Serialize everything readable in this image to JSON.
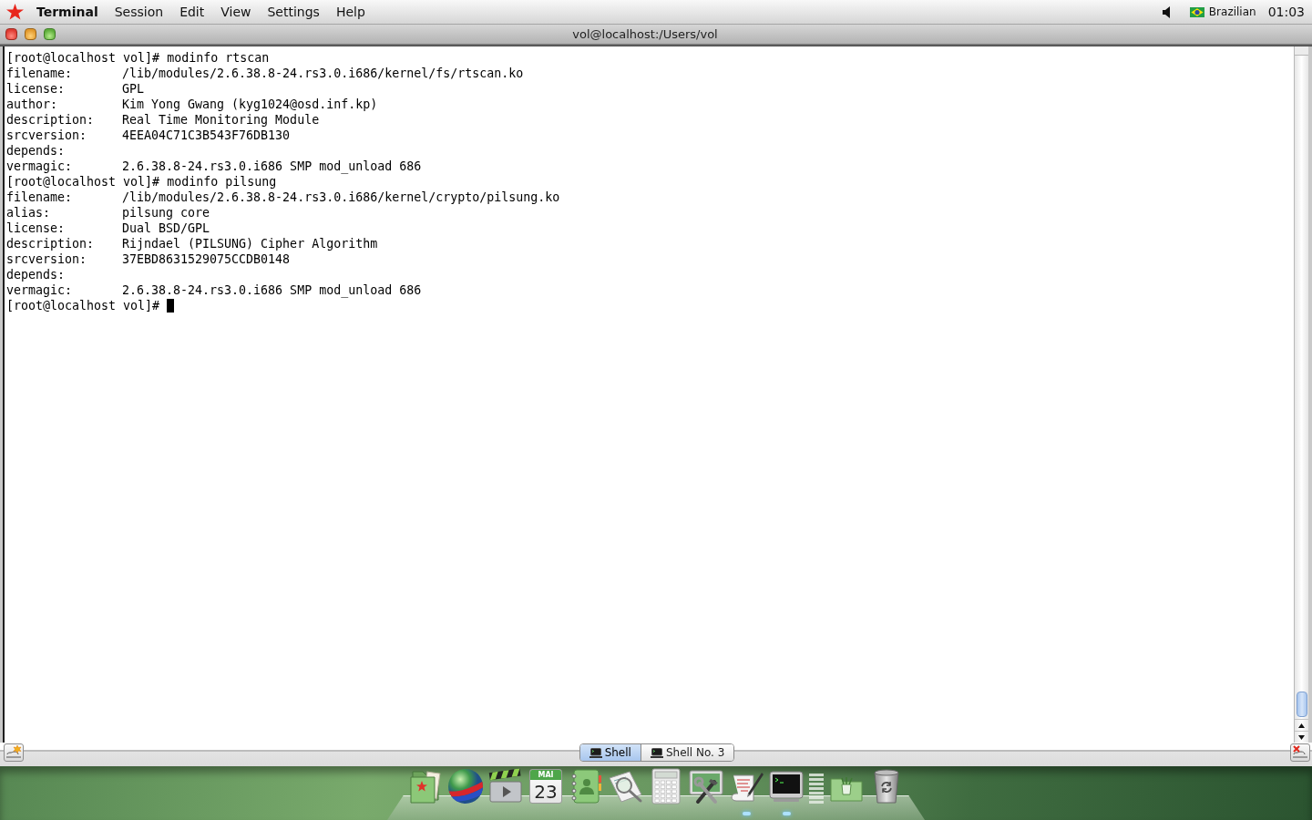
{
  "menu_bar": {
    "app_menu": "Terminal",
    "menus": [
      "Session",
      "Edit",
      "View",
      "Settings",
      "Help"
    ],
    "input_source": "Brazilian",
    "clock": "01:03"
  },
  "window": {
    "title": "vol@localhost:/Users/vol"
  },
  "terminal": {
    "lines": [
      {
        "kind": "prompt",
        "prompt": "[root@localhost vol]#",
        "command": "modinfo rtscan"
      },
      {
        "kind": "field",
        "key": "filename:",
        "value": "/lib/modules/2.6.38.8-24.rs3.0.i686/kernel/fs/rtscan.ko"
      },
      {
        "kind": "field",
        "key": "license:",
        "value": "GPL"
      },
      {
        "kind": "field",
        "key": "author:",
        "value": "Kim Yong Gwang (kyg1024@osd.inf.kp)"
      },
      {
        "kind": "field",
        "key": "description:",
        "value": "Real Time Monitoring Module"
      },
      {
        "kind": "field",
        "key": "srcversion:",
        "value": "4EEA04C71C3B543F76DB130"
      },
      {
        "kind": "field",
        "key": "depends:"
      },
      {
        "kind": "field",
        "key": "vermagic:",
        "value": "2.6.38.8-24.rs3.0.i686 SMP mod_unload 686"
      },
      {
        "kind": "prompt",
        "prompt": "[root@localhost vol]#",
        "command": "modinfo pilsung"
      },
      {
        "kind": "field",
        "key": "filename:",
        "value": "/lib/modules/2.6.38.8-24.rs3.0.i686/kernel/crypto/pilsung.ko"
      },
      {
        "kind": "field",
        "key": "alias:",
        "value": "pilsung core"
      },
      {
        "kind": "field",
        "key": "license:",
        "value": "Dual BSD/GPL"
      },
      {
        "kind": "field",
        "key": "description:",
        "value": "Rijndael (PILSUNG) Cipher Algorithm"
      },
      {
        "kind": "field",
        "key": "srcversion:",
        "value": "37EBD8631529075CCDB0148"
      },
      {
        "kind": "field",
        "key": "depends:"
      },
      {
        "kind": "field",
        "key": "vermagic:",
        "value": "2.6.38.8-24.rs3.0.i686 SMP mod_unload 686"
      },
      {
        "kind": "prompt",
        "prompt": "[root@localhost vol]#"
      }
    ],
    "cursor": true
  },
  "tabs": [
    {
      "label": "Shell",
      "selected": true
    },
    {
      "label": "Shell No. 3",
      "selected": false
    }
  ],
  "dock": {
    "items": [
      {
        "kind": "app-folder",
        "running": false
      },
      {
        "kind": "globe",
        "running": false
      },
      {
        "kind": "clapper",
        "running": false
      },
      {
        "kind": "calendar",
        "month": "MAI",
        "day": "23",
        "running": false
      },
      {
        "kind": "contacts",
        "running": false
      },
      {
        "kind": "preview",
        "running": false
      },
      {
        "kind": "calculator",
        "running": false
      },
      {
        "kind": "tools",
        "running": false
      },
      {
        "kind": "script",
        "running": true
      },
      {
        "kind": "terminal",
        "running": true
      },
      {
        "kind": "stack",
        "running": false
      },
      {
        "kind": "folder",
        "running": false
      },
      {
        "kind": "trash",
        "running": false
      }
    ]
  }
}
